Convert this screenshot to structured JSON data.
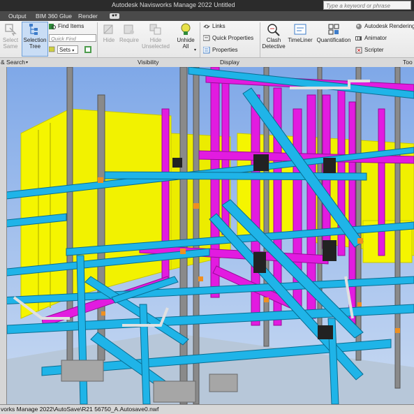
{
  "window": {
    "title": "Autodesk Navisworks Manage 2022    Untitled"
  },
  "search": {
    "placeholder": "Type a keyword or phrase"
  },
  "tabs": [
    "Output",
    "BIM 360 Glue",
    "Render"
  ],
  "ribbon": {
    "select_same": "Select\nSame",
    "selection_tree": "Selection\nTree",
    "find_items": "Find Items",
    "quick_find_placeholder": "Quick Find",
    "sets": "Sets",
    "hide": "Hide",
    "require": "Require",
    "hide_unselected": "Hide\nUnselected",
    "unhide_all": "Unhide\nAll",
    "links": "Links",
    "quick_properties": "Quick Properties",
    "properties": "Properties",
    "clash_detective": "Clash\nDetective",
    "timeliner": "TimeLiner",
    "quantification": "Quantification",
    "autodesk_rendering": "Autodesk Rendering",
    "animator": "Animator",
    "scripter": "Scripter"
  },
  "panels": {
    "select_search": "& Search",
    "visibility": "Visibility",
    "display": "Display",
    "tools": "Too"
  },
  "colors": {
    "sky_top": "#7fa8e8",
    "sky_bottom": "#c9daf2",
    "beam_cyan": "#1fb4e8",
    "pipe_magenta": "#e21be0",
    "wall_yellow": "#f5f500",
    "column_grey": "#8a8a8a",
    "accent_orange": "#f09020"
  },
  "status": {
    "path": "vorks Manage 2022\\AutoSave\\R21 56750_A.Autosave0.nwf"
  }
}
